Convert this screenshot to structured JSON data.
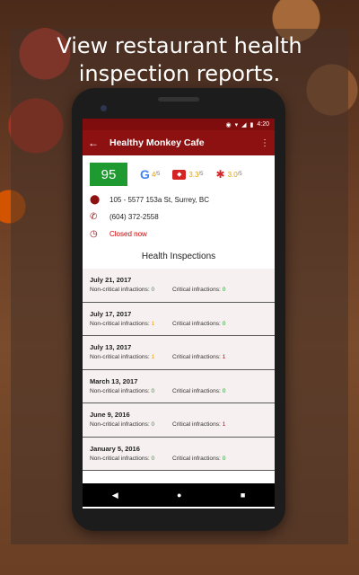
{
  "promo": {
    "headline": "View restaurant health inspection reports."
  },
  "status": {
    "time": "4:20",
    "icons": [
      "location-icon",
      "wifi-icon",
      "signal-icon",
      "battery-icon"
    ]
  },
  "appbar": {
    "title": "Healthy Monkey Cafe",
    "back_icon": "back-arrow-icon",
    "menu_icon": "more-vert-icon"
  },
  "ratings": {
    "score": "95",
    "score_color": "#1e9a30",
    "google": {
      "value": "4",
      "denom": "/5"
    },
    "zomato": {
      "value": "3.3",
      "denom": "/5"
    },
    "yelp": {
      "value": "3.0",
      "denom": "/5"
    }
  },
  "info": {
    "address": "105 - 5577 153a St, Surrey, BC",
    "phone": "(604) 372-2558",
    "hours": "Closed now"
  },
  "section_title": "Health Inspections",
  "labels": {
    "noncritical": "Non-critical infractions:",
    "critical": "Critical infractions:"
  },
  "inspections": [
    {
      "date": "July 21, 2017",
      "noncritical": "0",
      "critical": "0"
    },
    {
      "date": "July 17, 2017",
      "noncritical": "1",
      "critical": "0"
    },
    {
      "date": "July 13, 2017",
      "noncritical": "1",
      "critical": "1"
    },
    {
      "date": "March 13, 2017",
      "noncritical": "0",
      "critical": "0"
    },
    {
      "date": "June 9, 2016",
      "noncritical": "0",
      "critical": "1"
    },
    {
      "date": "January 5, 2016",
      "noncritical": "0",
      "critical": "0"
    }
  ],
  "navbar": {
    "back": "◀",
    "home": "●",
    "recents": "■"
  }
}
